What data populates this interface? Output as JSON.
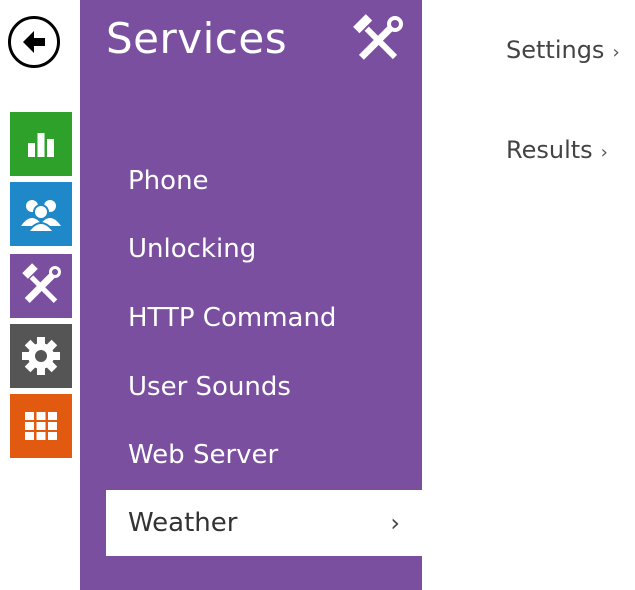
{
  "colors": {
    "accent": "#7b4fa0",
    "rail_status": "#2ea12b",
    "rail_directory": "#1e88c8",
    "rail_services": "#7b4fa0",
    "rail_hardware": "#555555",
    "rail_system": "#e25a0f"
  },
  "back": {
    "icon": "back-arrow-icon"
  },
  "rail": [
    {
      "name": "status",
      "icon": "bar-chart-icon"
    },
    {
      "name": "directory",
      "icon": "users-icon"
    },
    {
      "name": "services",
      "icon": "tools-icon"
    },
    {
      "name": "hardware",
      "icon": "gear-icon"
    },
    {
      "name": "system",
      "icon": "grid-icon"
    }
  ],
  "sidebar": {
    "title": "Services",
    "title_icon": "tools-icon",
    "items": [
      {
        "label": "Phone"
      },
      {
        "label": "Unlocking"
      },
      {
        "label": "HTTP Command"
      },
      {
        "label": "User Sounds"
      },
      {
        "label": "Web Server"
      },
      {
        "label": "Weather",
        "active": true,
        "chevron": "›"
      }
    ]
  },
  "main": {
    "links": [
      {
        "label": "Settings",
        "chevron": "›"
      },
      {
        "label": "Results",
        "chevron": "›"
      }
    ]
  }
}
